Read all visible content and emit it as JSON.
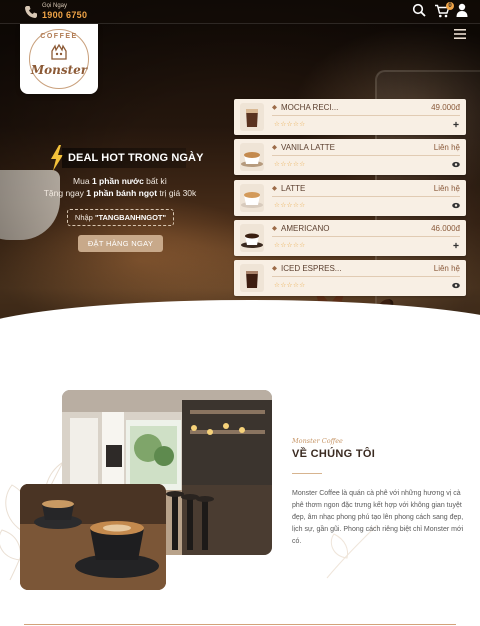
{
  "header": {
    "call_label": "Gọi Ngay",
    "phone": "1900 6750",
    "cart_count": "0"
  },
  "logo": {
    "top_text": "COFFEE",
    "brand_text": "Monster"
  },
  "promo": {
    "title": "DEAL HOT TRONG NGÀY",
    "line1_prefix": "Mua ",
    "line1_bold": "1 phần nước",
    "line1_suffix": " bất kì",
    "line2_prefix": "Tặng ngay ",
    "line2_bold": "1 phần bánh ngọt",
    "line2_suffix": " trị giá 30k",
    "code_prefix": "Nhập ",
    "code": "\"TANGBANHNGOT\"",
    "button": "ĐẶT HÀNG NGAY"
  },
  "products": [
    {
      "name": "MOCHA RECI...",
      "price": "49.000đ",
      "stars": "☆☆☆☆☆",
      "action_icon": "plus-icon"
    },
    {
      "name": "VANILA LATTE",
      "price": "Liên hệ",
      "stars": "☆☆☆☆☆",
      "action_icon": "eye-icon"
    },
    {
      "name": "LATTE",
      "price": "Liên hệ",
      "stars": "☆☆☆☆☆",
      "action_icon": "eye-icon"
    },
    {
      "name": "AMERICANO",
      "price": "46.000đ",
      "stars": "☆☆☆☆☆",
      "action_icon": "plus-icon"
    },
    {
      "name": "ICED ESPRES...",
      "price": "Liên hệ",
      "stars": "☆☆☆☆☆",
      "action_icon": "eye-icon"
    }
  ],
  "about": {
    "subtitle": "Monster Coffee",
    "title": "VỀ CHÚNG TÔI",
    "text": "Monster Coffee là quán cà phê với những hương vị cà phê thơm ngon đặc trưng kết hợp với không gian tuyệt đẹp, âm nhạc phong phú tạo lên phong cách sang đẹp, lịch sự, gần gũi. Phong cách riêng biệt chỉ Monster mới có."
  },
  "colors": {
    "accent": "#f0a447",
    "brand_brown": "#8c5a36",
    "card_bg": "#f8efe4"
  }
}
